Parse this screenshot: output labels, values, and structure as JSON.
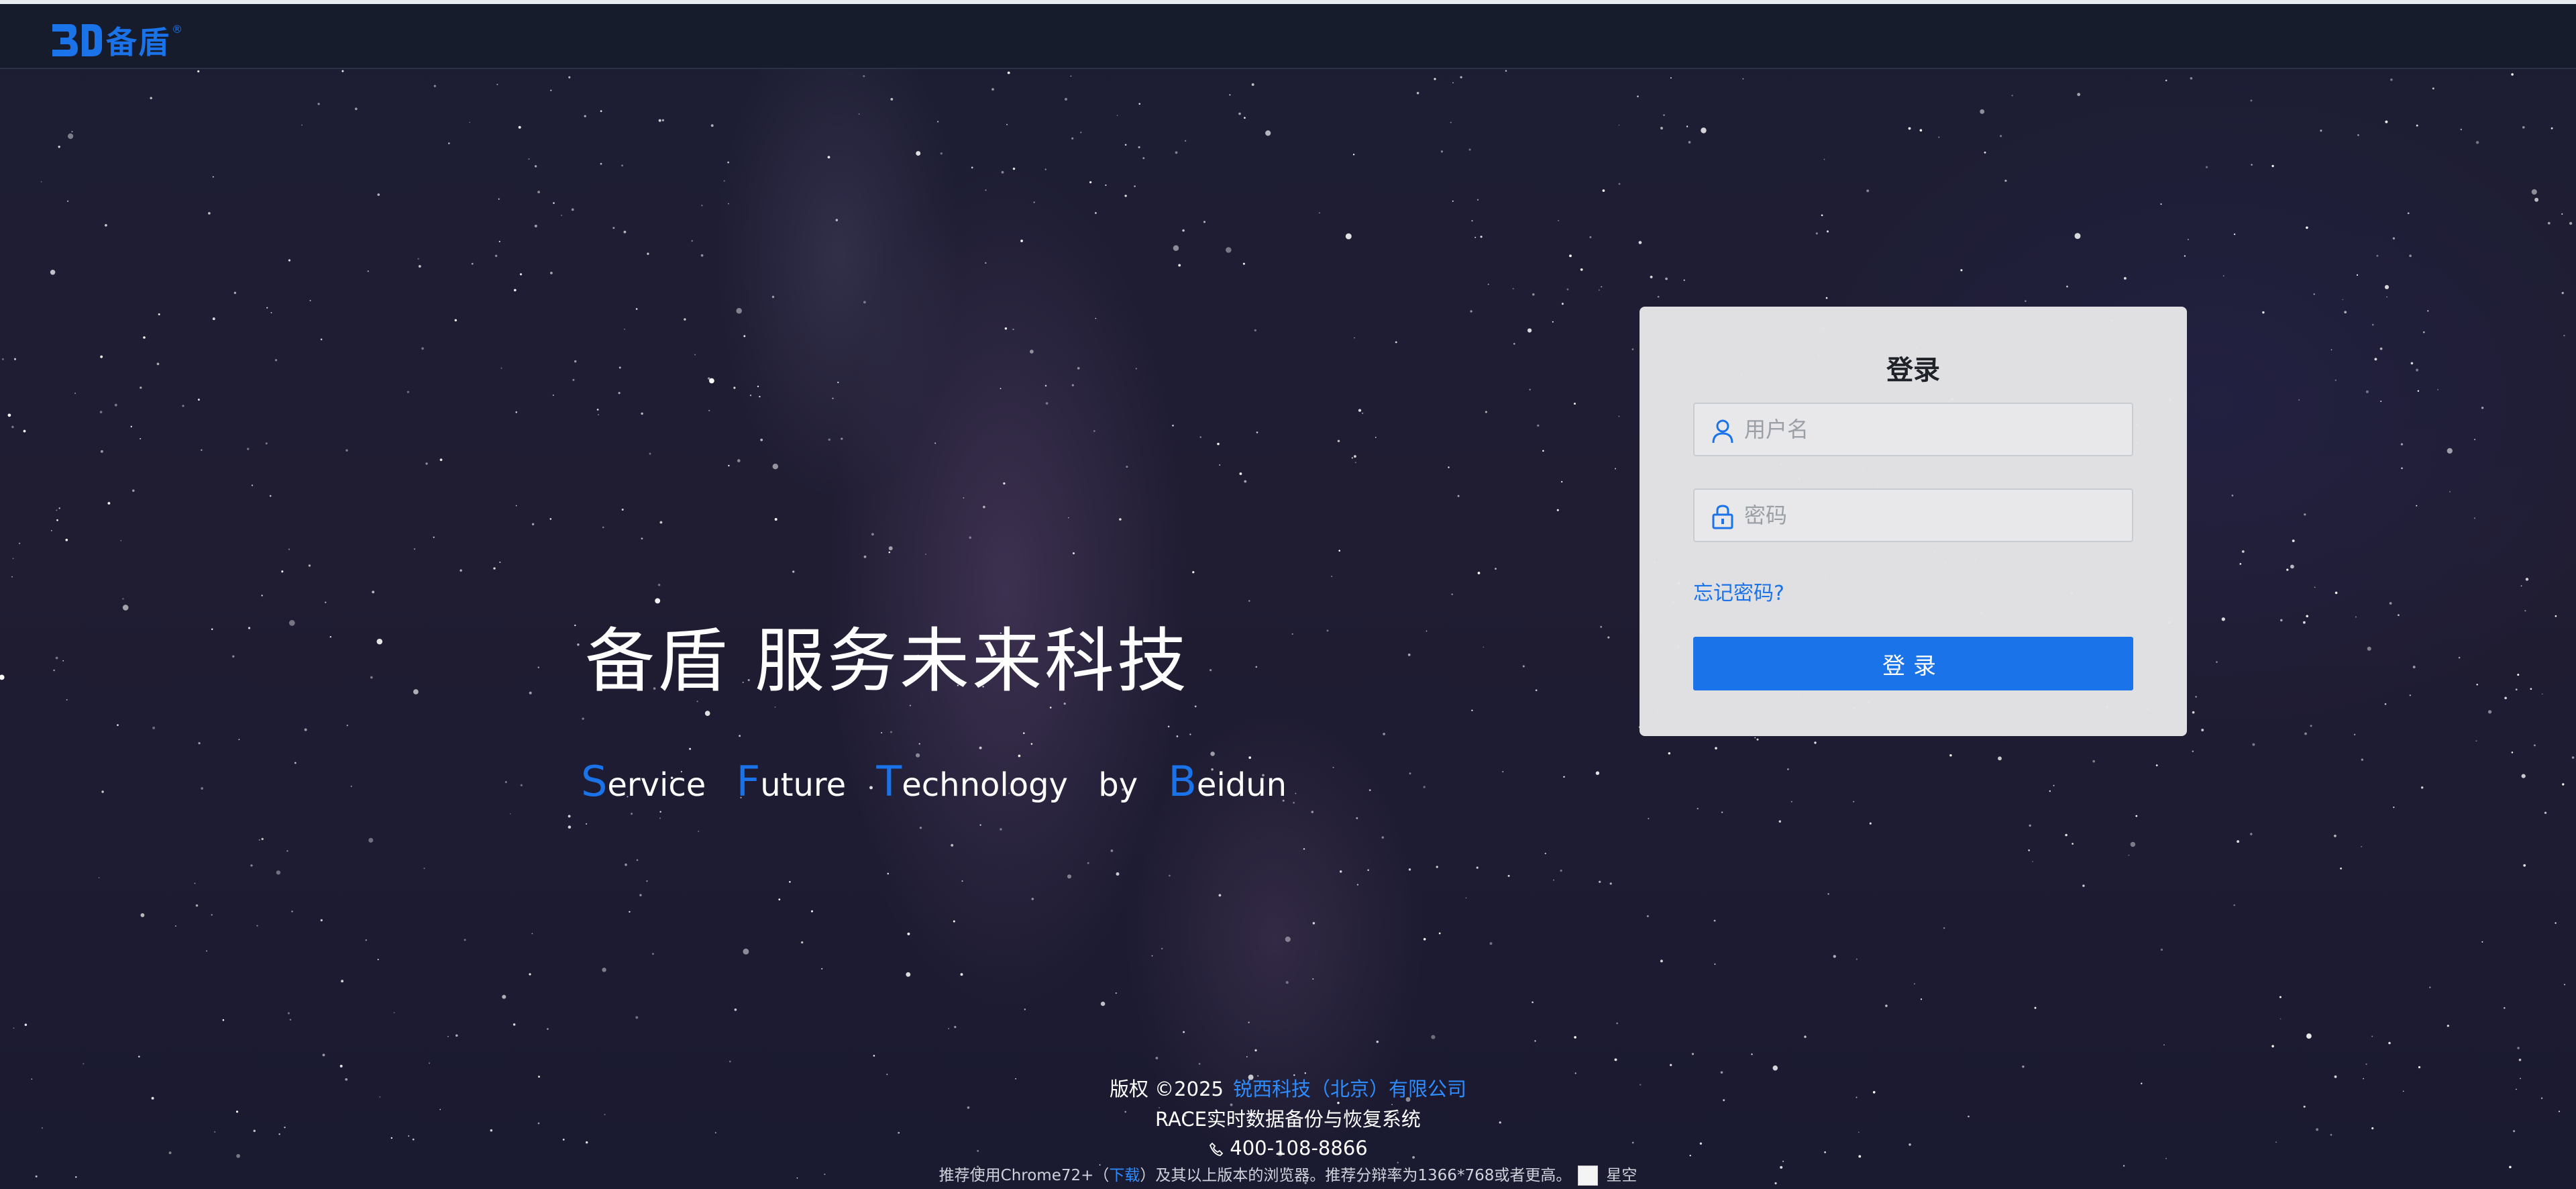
{
  "header": {
    "logo_text": "备盾",
    "logo_reg": "®",
    "brand_color": "#1a73e8"
  },
  "slogan": {
    "cn": "备盾 服务未来科技",
    "en_words": [
      {
        "cap": "S",
        "rest": "ervice"
      },
      {
        "cap": "F",
        "rest": "uture"
      },
      {
        "cap": "T",
        "rest": "echnology"
      },
      {
        "cap": "",
        "rest": "by"
      },
      {
        "cap": "B",
        "rest": "eidun"
      }
    ]
  },
  "login": {
    "title": "登录",
    "username_placeholder": "用户名",
    "password_placeholder": "密码",
    "forgot_label": "忘记密码?",
    "submit_label": "登录",
    "icons": [
      "user-icon",
      "lock-icon"
    ]
  },
  "footer": {
    "copyright": "版权 ©2025",
    "company": "锐西科技（北京）有限公司",
    "product": "RACE实时数据备份与恢复系统",
    "phone": "400-108-8866",
    "browser_prefix": "推荐使用Chrome72+（",
    "download_label": "下载",
    "browser_suffix": "）及其以上版本的浏览器。推荐分辩率为1366*768或者更高。",
    "theme_label": "星空"
  }
}
